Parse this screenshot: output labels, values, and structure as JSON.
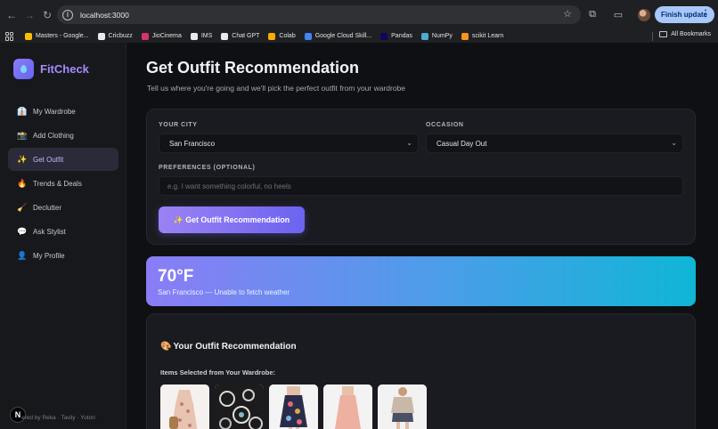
{
  "browser": {
    "url": "localhost:3000",
    "update_label": "Finish update",
    "bookmarks": [
      {
        "label": "Masters - Google...",
        "color": "#fbbc04"
      },
      {
        "label": "Cricbuzz",
        "color": "#e8eaed"
      },
      {
        "label": "JioCinema",
        "color": "#d6336c"
      },
      {
        "label": "IMS",
        "color": "#e8eaed"
      },
      {
        "label": "Chat GPT",
        "color": "#e8eaed"
      },
      {
        "label": "Colab",
        "color": "#f9ab00"
      },
      {
        "label": "Google Cloud Skill...",
        "color": "#4285f4"
      },
      {
        "label": "Pandas",
        "color": "#150458"
      },
      {
        "label": "NumPy",
        "color": "#4dabcf"
      },
      {
        "label": "scikit Learn",
        "color": "#f7931e"
      }
    ],
    "all_bookmarks": "All Bookmarks"
  },
  "sidebar": {
    "brand": "FitCheck",
    "items": [
      {
        "icon": "👔",
        "label": "My Wardrobe",
        "active": false
      },
      {
        "icon": "📸",
        "label": "Add Clothing",
        "active": false
      },
      {
        "icon": "✨",
        "label": "Get Outfit",
        "active": true
      },
      {
        "icon": "🔥",
        "label": "Trends & Deals",
        "active": false
      },
      {
        "icon": "🧹",
        "label": "Declutter",
        "active": false
      },
      {
        "icon": "💬",
        "label": "Ask Stylist",
        "active": false
      },
      {
        "icon": "👤",
        "label": "My Profile",
        "active": false
      }
    ],
    "footer": "ered by Reka · Tavily · Yutori",
    "badge": "N"
  },
  "main": {
    "title": "Get Outfit Recommendation",
    "subtitle": "Tell us where you're going and we'll pick the perfect outfit from your wardrobe",
    "form": {
      "city_label": "YOUR CITY",
      "city_value": "San Francisco",
      "occasion_label": "OCCASION",
      "occasion_value": "Casual Day Out",
      "prefs_label": "PREFERENCES (OPTIONAL)",
      "prefs_placeholder": "e.g. I want something colorful, no heels",
      "submit_label": "✨ Get Outfit Recommendation"
    },
    "weather": {
      "temp": "70°F",
      "desc": "San Francisco — Unable to fetch weather"
    },
    "recommendation": {
      "title": "Your Outfit Recommendation",
      "title_icon": "🎨",
      "items_label": "Items Selected from Your Wardrobe:",
      "items": [
        "floral-dress",
        "jewelry",
        "floral-mini-dress",
        "pink-dress",
        "top-and-shorts"
      ]
    }
  }
}
